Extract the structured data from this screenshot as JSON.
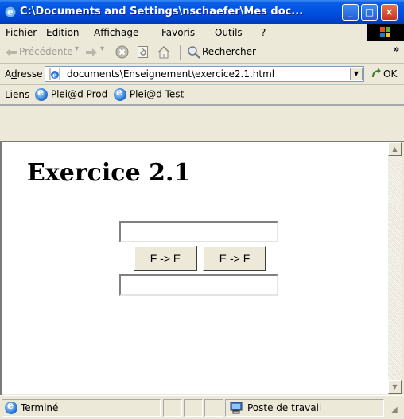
{
  "window": {
    "title": "C:\\Documents and Settings\\nschaefer\\Mes doc...",
    "controls": {
      "minimize": "_",
      "maximize": "□",
      "close": "×"
    }
  },
  "menubar": {
    "items": [
      {
        "label_pre": "",
        "label_key": "F",
        "label_post": "ichier"
      },
      {
        "label_pre": "",
        "label_key": "E",
        "label_post": "dition"
      },
      {
        "label_pre": "",
        "label_key": "A",
        "label_post": "ffichage"
      },
      {
        "label_pre": "Fa",
        "label_key": "v",
        "label_post": "oris"
      },
      {
        "label_pre": "",
        "label_key": "O",
        "label_post": "utils"
      },
      {
        "label_pre": "",
        "label_key": "?",
        "label_post": ""
      }
    ]
  },
  "toolbar": {
    "back_label": "Précédente",
    "search_label": "Rechercher",
    "overflow": "»"
  },
  "addressbar": {
    "label_pre": "A",
    "label_key": "d",
    "label_post": "resse",
    "value": "documents\\Enseignement\\exercice2.1.html",
    "go_label": "OK"
  },
  "linksbar": {
    "label": "Liens",
    "links": [
      "Plei@d Prod",
      "Plei@d Test"
    ]
  },
  "page": {
    "heading": "Exercice 2.1",
    "input_top_value": "",
    "input_bottom_value": "",
    "btn_f_to_e": "F -> E",
    "btn_e_to_f": "E -> F"
  },
  "statusbar": {
    "status": "Terminé",
    "zone": "Poste de travail"
  }
}
